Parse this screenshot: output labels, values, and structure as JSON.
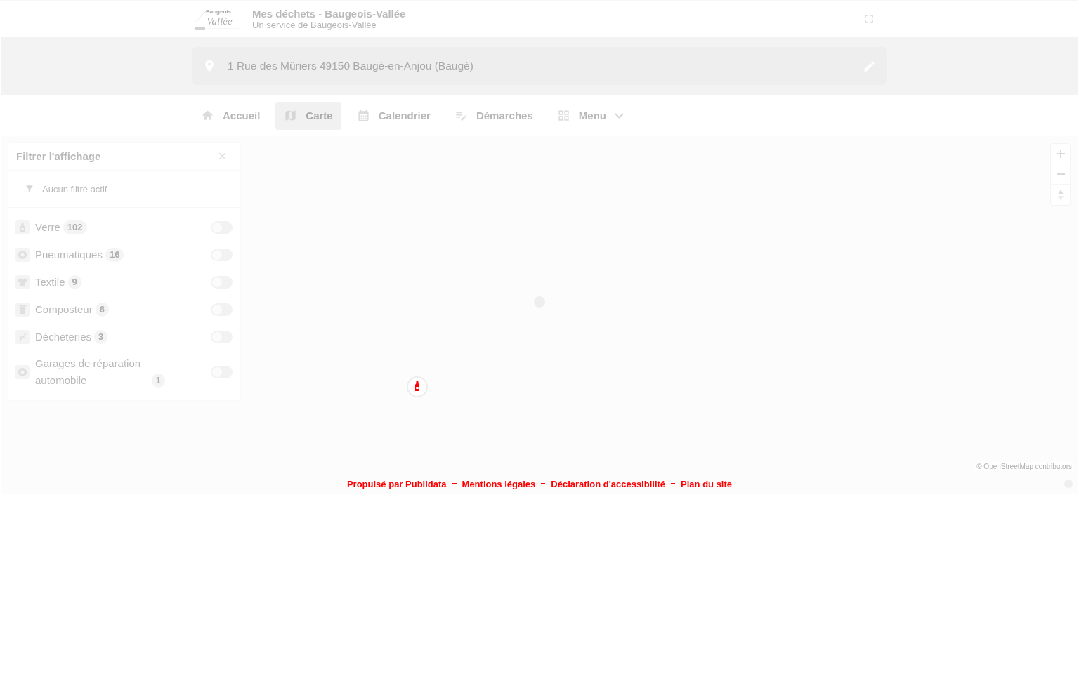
{
  "header": {
    "logo": {
      "top": "Baugeois",
      "bottom": "Vallée"
    },
    "title": "Mes déchets - Baugeois-Vallée",
    "subtitle": "Un service de Baugeois-Vallée"
  },
  "address": {
    "value": "1 Rue des Mûriers 49150 Baugé-en-Anjou (Baugé)"
  },
  "nav": {
    "items": [
      {
        "label": "Accueil",
        "selected": false,
        "kind": "link"
      },
      {
        "label": "Carte",
        "selected": true,
        "kind": "link"
      },
      {
        "label": "Calendrier",
        "selected": false,
        "kind": "link"
      },
      {
        "label": "Démarches",
        "selected": false,
        "kind": "link"
      },
      {
        "label": "Menu",
        "selected": false,
        "kind": "dropdown",
        "expanded": false
      }
    ]
  },
  "filter_panel": {
    "title": "Filtrer l'affichage",
    "status": "Aucun filtre actif",
    "items": [
      {
        "label": "Verre",
        "count": "102",
        "on": false
      },
      {
        "label": "Pneumatiques",
        "count": "16",
        "on": false
      },
      {
        "label": "Textile",
        "count": "9",
        "on": false
      },
      {
        "label": "Composteur",
        "count": "6",
        "on": false
      },
      {
        "label": "Déchèteries",
        "count": "3",
        "on": false
      },
      {
        "label": "Garages de réparation automobile",
        "count": "1",
        "on": false
      }
    ]
  },
  "map": {
    "attribution": "© OpenStreetMap contributors"
  },
  "footer": {
    "links": [
      "Propulsé par Publidata",
      "Mentions légales",
      "Déclaration d'accessibilité",
      "Plan du site"
    ]
  }
}
